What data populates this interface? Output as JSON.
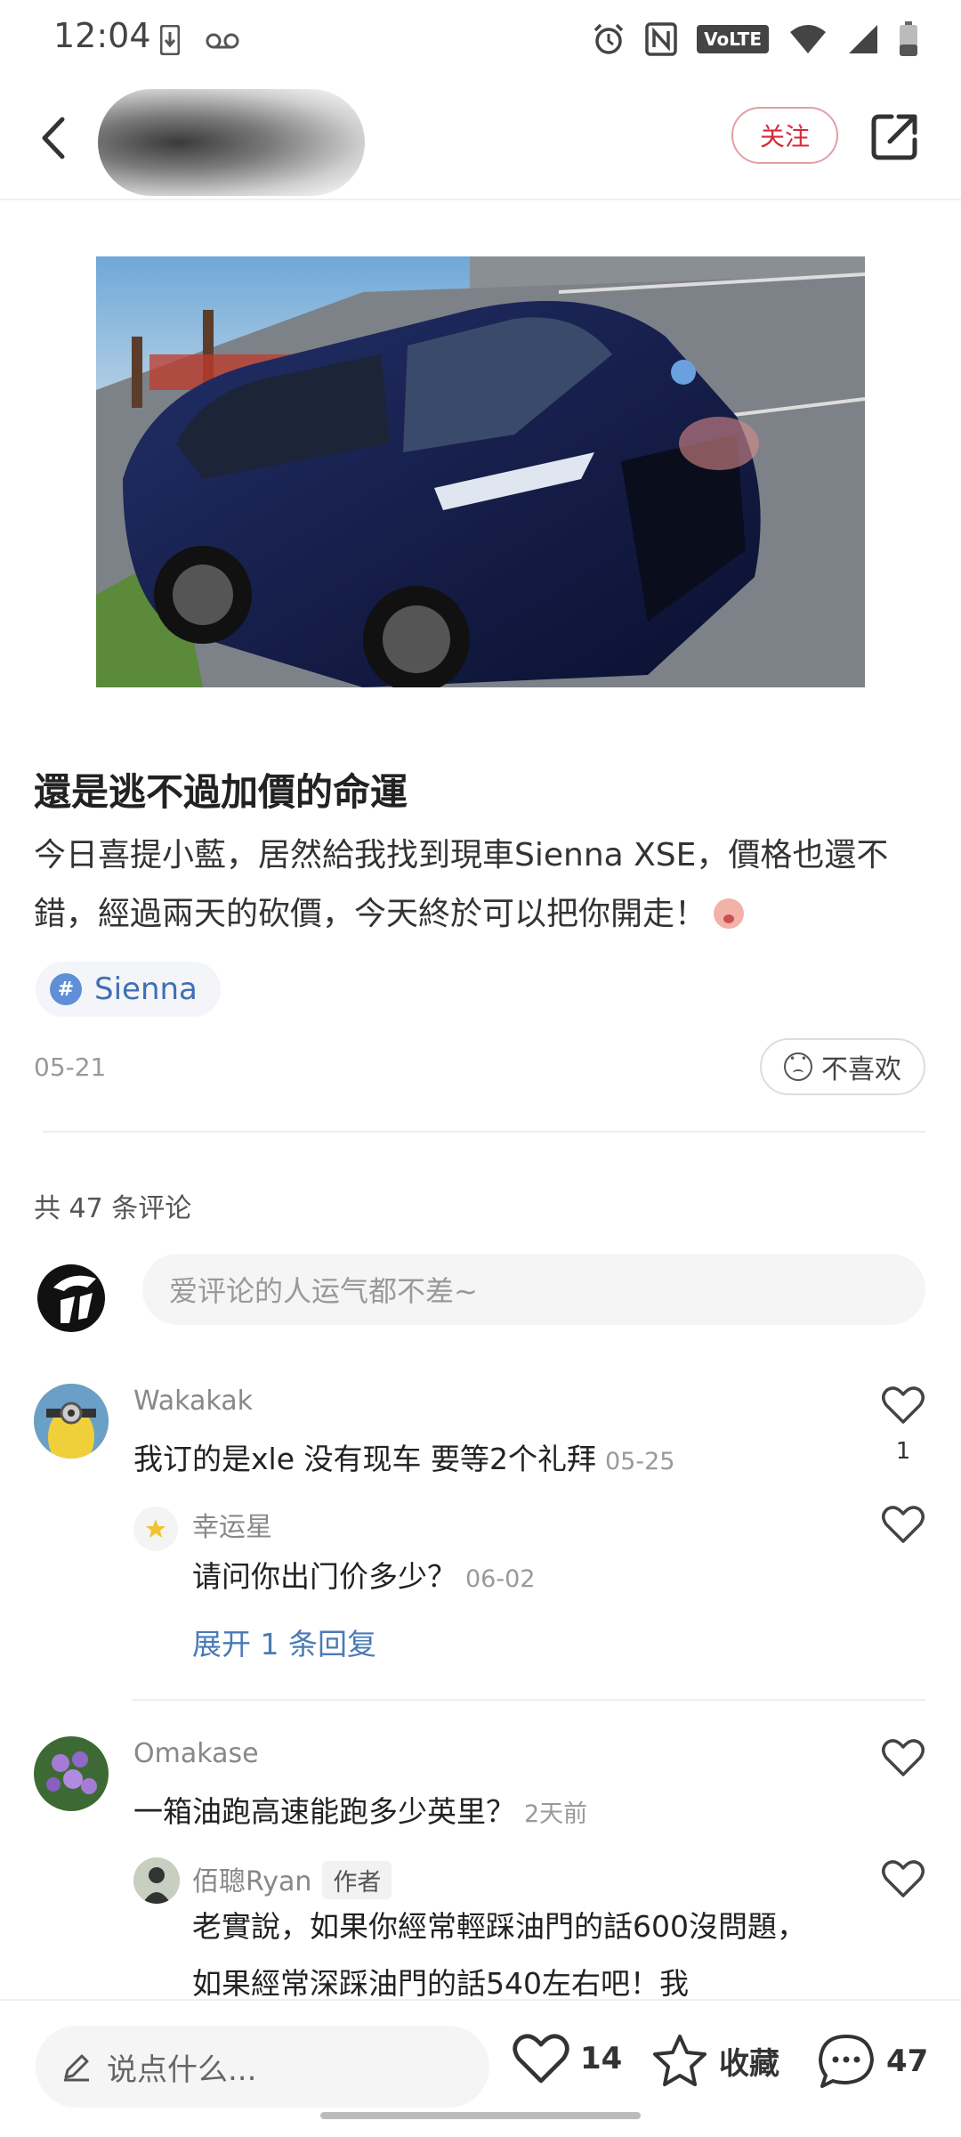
{
  "status_bar": {
    "time": "12:04",
    "left_icons": [
      "download-icon",
      "voicemail-icon"
    ],
    "right_icons": [
      "alarm-icon",
      "nfc-icon",
      "volte-icon",
      "wifi-icon",
      "signal-icon",
      "battery-icon"
    ],
    "volte_label": "VoLTE"
  },
  "header": {
    "follow_label": "关注",
    "back_icon": "back-arrow-icon",
    "share_icon": "share-icon"
  },
  "post": {
    "title": "還是逃不過加價的命運",
    "body": "今日喜提小藍，居然給我找到現車Sienna XSE，價格也還不錯，經過兩天的砍價，今天終於可以把你開走！",
    "tag": "Sienna",
    "tag_icon": "#",
    "date": "05-21",
    "dislike_label": "不喜欢"
  },
  "comments_section": {
    "count_label": "共 47 条评论",
    "input_placeholder": "爱评论的人运气都不差~"
  },
  "comments": [
    {
      "name": "Wakakak",
      "text": "我订的是xle 没有现车 要等2个礼拜",
      "date": "05-25",
      "likes": "1",
      "replies": [
        {
          "name": "幸运星",
          "text": "请问你出门价多少？",
          "date": "06-02"
        }
      ],
      "expand_label": "展开 1 条回复"
    },
    {
      "name": "Omakase",
      "text": "一箱油跑高速能跑多少英里？",
      "date": "2天前",
      "replies": [
        {
          "name": "佰聰Ryan",
          "badge": "作者",
          "text": "老實說，如果你經常輕踩油門的話600沒問題，如果經常深踩油門的話540左右吧！我"
        }
      ]
    }
  ],
  "bottom_bar": {
    "input_placeholder": "说点什么...",
    "like_count": "14",
    "collect_label": "收藏",
    "comment_count": "47"
  },
  "colors": {
    "accent_red": "#d8293d",
    "link_blue": "#4a7ab5",
    "tag_blue": "#3f6fb4"
  }
}
